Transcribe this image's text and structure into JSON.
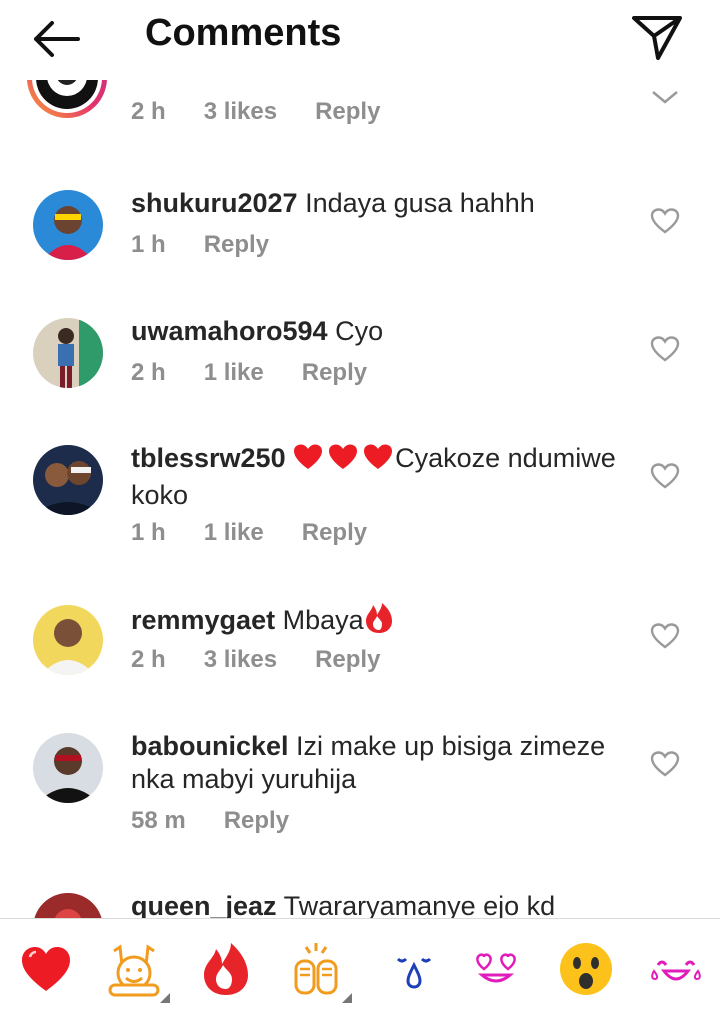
{
  "header": {
    "title": "Comments"
  },
  "comments": [
    {
      "username": "",
      "text": "",
      "time": "2 h",
      "likes": "3 likes",
      "reply": "Reply"
    },
    {
      "username": "shukuru2027",
      "text": "Indaya gusa hahhh",
      "time": "1 h",
      "likes": "",
      "reply": "Reply"
    },
    {
      "username": "uwamahoro594",
      "text": "Cyo",
      "time": "2 h",
      "likes": "1 like",
      "reply": "Reply"
    },
    {
      "username": "tblessrw250",
      "text": "Cyakoze ndumiwe koko",
      "time": "1 h",
      "likes": "1 like",
      "reply": "Reply"
    },
    {
      "username": "remmygaet",
      "text": "Mbaya",
      "time": "2 h",
      "likes": "3 likes",
      "reply": "Reply"
    },
    {
      "username": "babounickel",
      "text": "Izi make up bisiga zimeze nka mabyi yuruhija",
      "time": "58 m",
      "likes": "",
      "reply": "Reply"
    },
    {
      "username": "queen_jeaz",
      "text": "Twararyamanye ejo kd",
      "time": "",
      "likes": "",
      "reply": ""
    }
  ],
  "emoji_bar": [
    {
      "icon": "red-heart-icon"
    },
    {
      "icon": "raising-hands-icon"
    },
    {
      "icon": "fire-icon"
    },
    {
      "icon": "clapping-hands-icon"
    },
    {
      "icon": "crying-face-icon"
    },
    {
      "icon": "heart-eyes-icon"
    },
    {
      "icon": "surprised-face-icon"
    },
    {
      "icon": "laughing-tears-icon"
    }
  ],
  "colors": {
    "heart": "#ed1c24",
    "fire": "#e8242b",
    "muted": "#8e8e8e",
    "text": "#262626"
  }
}
